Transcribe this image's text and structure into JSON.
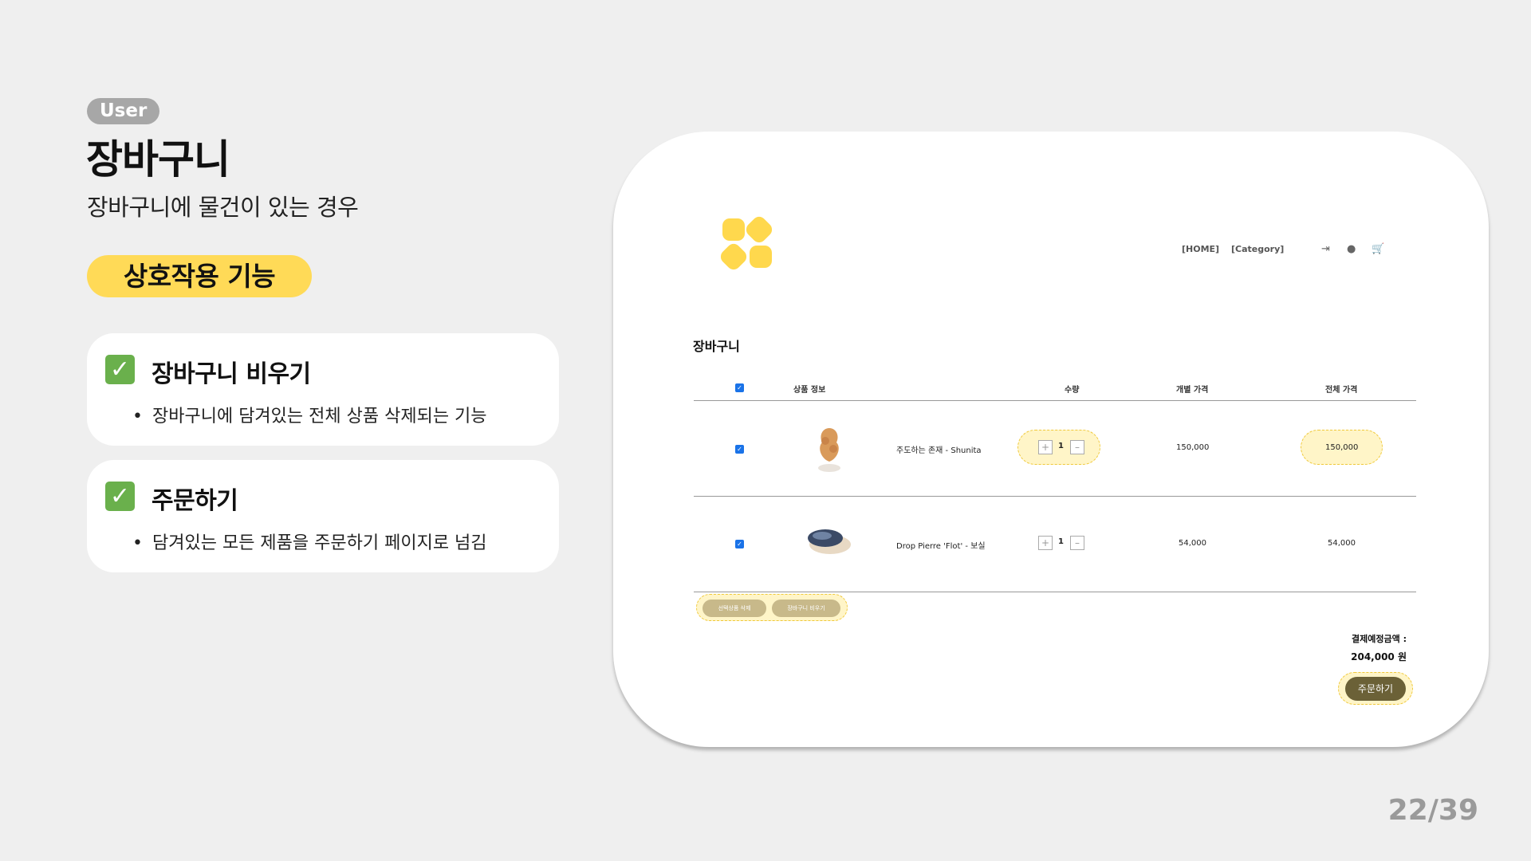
{
  "header": {
    "badge": "User",
    "title": "장바구니",
    "subtitle": "장바구니에 물건이 있는 경우",
    "feature_label": "상호작용 기능"
  },
  "features": [
    {
      "title": "장바구니 비우기",
      "desc": "장바구니에 담겨있는 전체 상품 삭제되는 기능"
    },
    {
      "title": "주문하기",
      "desc": "담겨있는 모든 제품을 주문하기 페이지로 넘김"
    }
  ],
  "page_number": "22/39",
  "screenshot": {
    "nav": {
      "home": "[HOME]",
      "category": "[Category]"
    },
    "icons": [
      "logout-icon",
      "user-icon",
      "cart-icon"
    ],
    "cart_title": "장바구니",
    "columns": {
      "product": "상품 정보",
      "qty": "수량",
      "unit_price": "개별 가격",
      "total_price": "전체 가격"
    },
    "items": [
      {
        "name": "주도하는 존재 - Shunita",
        "qty": "1",
        "unit_price": "150,000",
        "total_price": "150,000"
      },
      {
        "name": "Drop Pierre 'Flot' - 보실",
        "qty": "1",
        "unit_price": "54,000",
        "total_price": "54,000"
      }
    ],
    "delete_selected": "선택상품 삭제",
    "empty_cart": "장바구니 비우기",
    "total_label": "결제예정금액 :",
    "total_value": "204,000 원",
    "order_button": "주문하기",
    "accent": "#ffda57"
  }
}
